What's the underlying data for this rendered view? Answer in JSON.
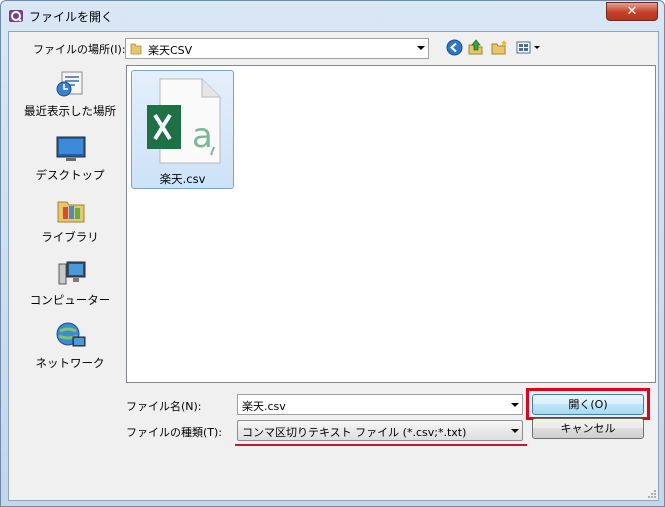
{
  "window": {
    "title": "ファイルを開く",
    "close_label": "✕"
  },
  "toolbar": {
    "location_label": "ファイルの場所(I):",
    "location_value": "楽天CSV"
  },
  "places": [
    {
      "label": "最近表示した場所",
      "icon": "recent-places-icon"
    },
    {
      "label": "デスクトップ",
      "icon": "desktop-icon"
    },
    {
      "label": "ライブラリ",
      "icon": "libraries-icon"
    },
    {
      "label": "コンピューター",
      "icon": "computer-icon"
    },
    {
      "label": "ネットワーク",
      "icon": "network-icon"
    }
  ],
  "files": [
    {
      "name": "楽天.csv",
      "icon": "excel-csv-icon"
    }
  ],
  "bottom": {
    "filename_label": "ファイル名(N):",
    "filename_value": "楽天.csv",
    "filetype_label": "ファイルの種類(T):",
    "filetype_value": "コンマ区切りテキスト ファイル (*.csv;*.txt)",
    "open_label": "開く(O)",
    "cancel_label": "キャンセル"
  },
  "colors": {
    "highlight": "#e3001b",
    "excel_green": "#1e7145"
  }
}
